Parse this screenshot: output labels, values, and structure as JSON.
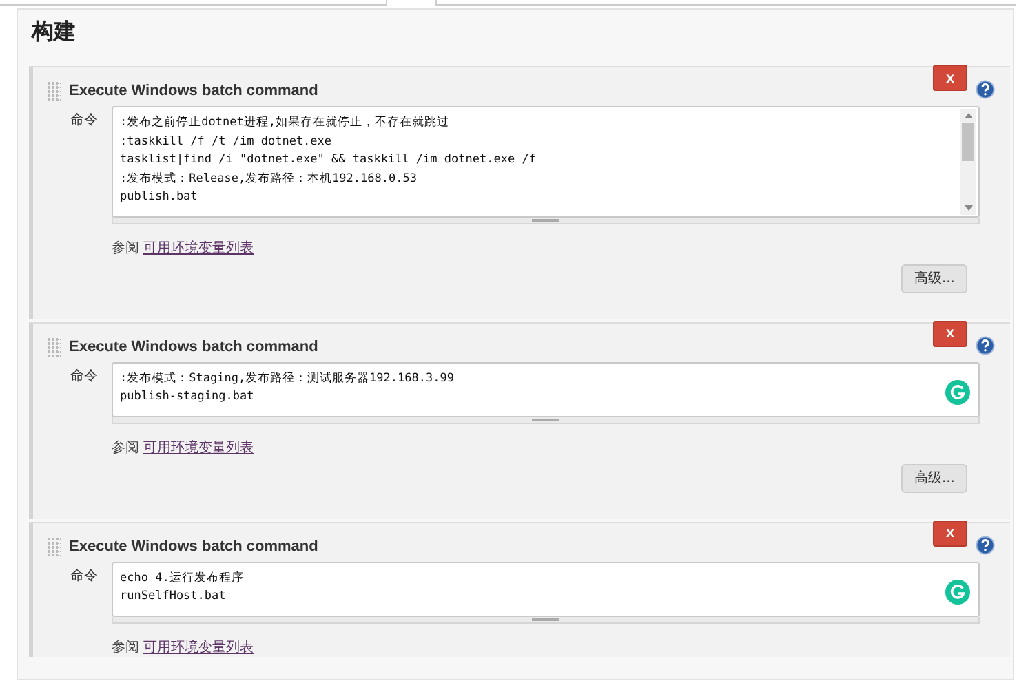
{
  "section": {
    "title": "构建"
  },
  "steps": [
    {
      "title": "Execute Windows batch command",
      "delete_label": "x",
      "field_label": "命令",
      "command": ":发布之前停止dotnet进程,如果存在就停止，不存在就跳过\n:taskkill /f /t /im dotnet.exe\ntasklist|find /i \"dotnet.exe\" && taskkill /im dotnet.exe /f\n:发布模式：Release,发布路径：本机192.168.0.53\npublish.bat",
      "assistant_icon": false,
      "see_prefix": "参阅",
      "see_link": "可用环境变量列表",
      "advanced_button": "高级..."
    },
    {
      "title": "Execute Windows batch command",
      "delete_label": "x",
      "field_label": "命令",
      "command": ":发布模式：Staging,发布路径：测试服务器192.168.3.99\npublish-staging.bat",
      "assistant_icon": true,
      "see_prefix": "参阅",
      "see_link": "可用环境变量列表",
      "advanced_button": "高级..."
    },
    {
      "title": "Execute Windows batch command",
      "delete_label": "x",
      "field_label": "命令",
      "command": "echo 4.运行发布程序\nrunSelfHost.bat",
      "assistant_icon": true,
      "see_prefix": "参阅",
      "see_link": "可用环境变量列表"
    }
  ]
}
